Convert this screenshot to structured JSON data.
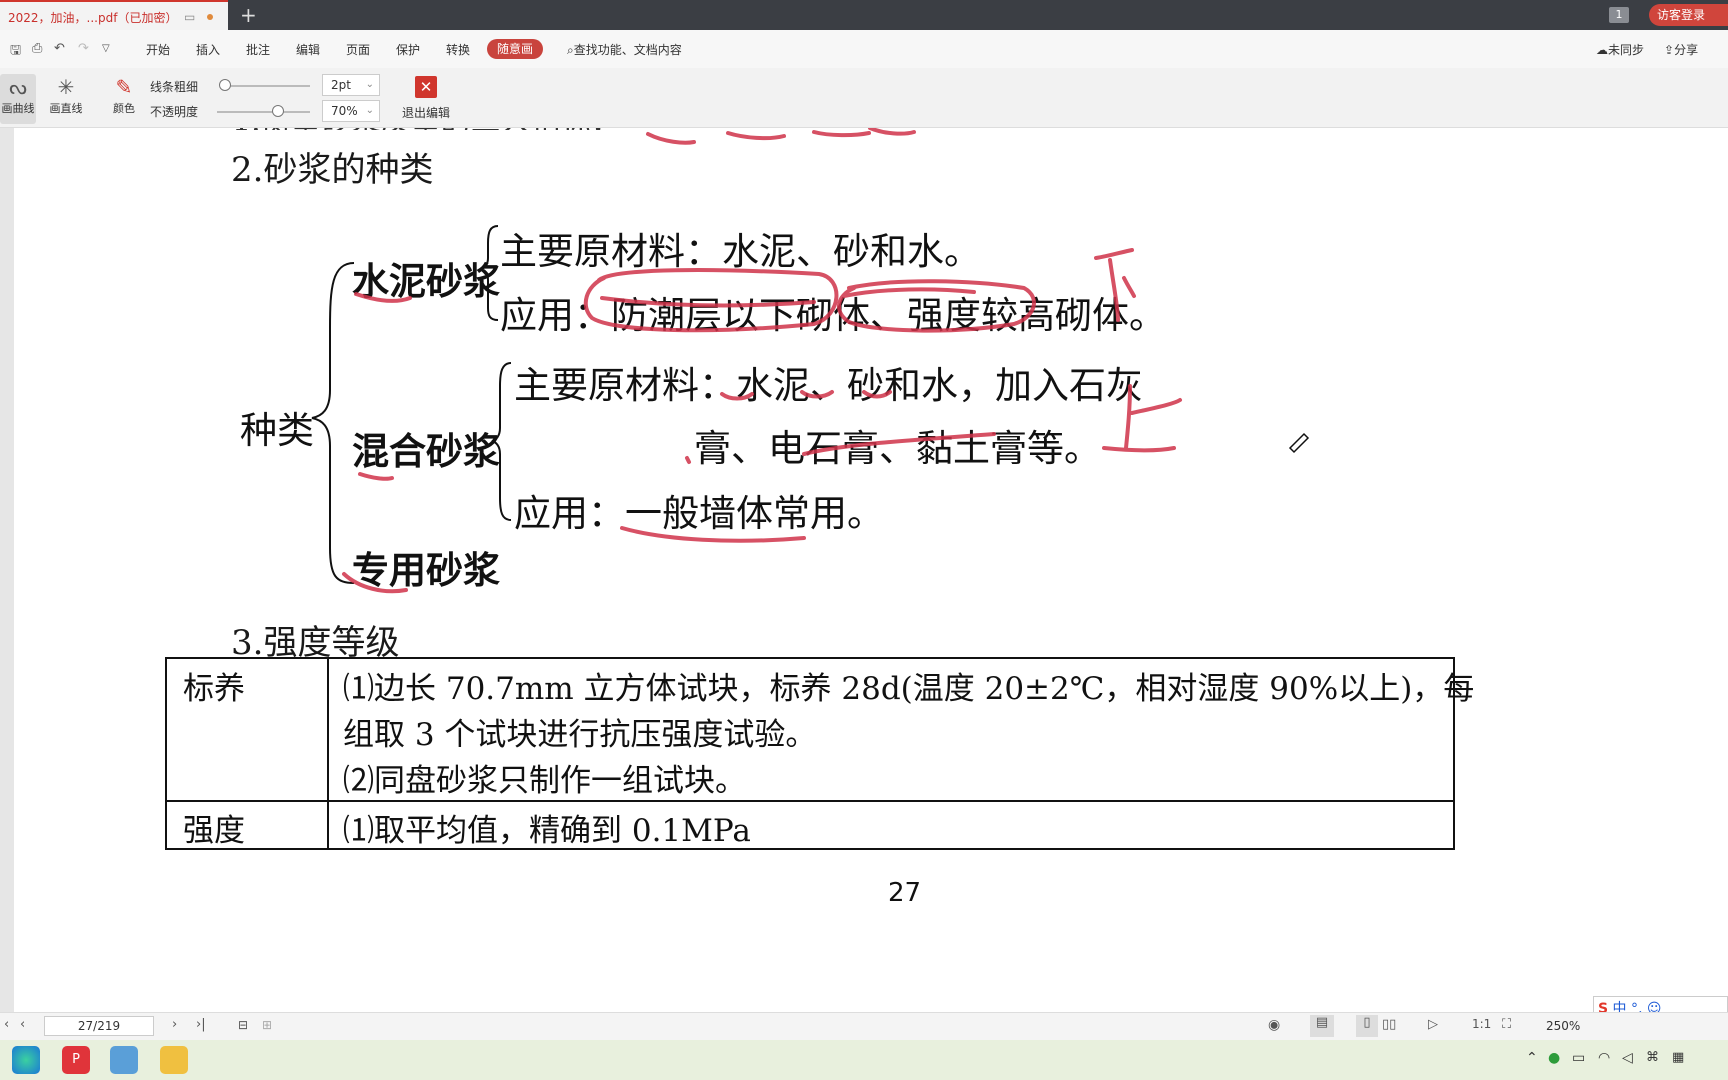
{
  "tab": {
    "title": "2022，加油，...pdf（已加密）"
  },
  "titlebar": {
    "page_count": "1",
    "login": "访客登录"
  },
  "menu": {
    "items": [
      "开始",
      "插入",
      "批注",
      "编辑",
      "页面",
      "保护",
      "转换"
    ],
    "active": "随意画",
    "search": "查找功能、文档内容",
    "sync": "未同步",
    "share": "分享"
  },
  "ink": {
    "curve": "画曲线",
    "line": "画直线",
    "color": "颜色",
    "thickness_label": "线条粗细",
    "thickness_value": "2pt",
    "opacity_label": "不透明度",
    "opacity_value": "70%",
    "opacity_level": 0.7,
    "exit": "退出编辑",
    "accent": "#d0362d"
  },
  "doc": {
    "section2": "2.砂浆的种类",
    "root": "种类",
    "cement": {
      "name": "水泥砂浆",
      "material": "主要原材料：水泥、砂和水。",
      "use": "应用：防潮层以下砌体、强度较高砌体。"
    },
    "mixed": {
      "name": "混合砂浆",
      "material_1": "主要原材料：水泥、砂和水，加入石灰",
      "material_2": "膏、电石膏、黏土膏等。",
      "use": "应用：一般墙体常用。"
    },
    "special": {
      "name": "专用砂浆"
    },
    "section3": "3.强度等级",
    "table": {
      "rows": [
        {
          "head": "标养",
          "lines": [
            "⑴边长 70.7mm 立方体试块，标养 28d(温度 20±2℃，相对湿度 90%以上)，每",
            "组取 3 个试块进行抗压强度试验。",
            "⑵同盘砂浆只制作一组试块。"
          ]
        },
        {
          "head": "强度",
          "lines": [
            "⑴取平均值，精确到 0.1MPa"
          ]
        }
      ]
    },
    "page_number": "27",
    "handwriting": {
      "lower": "下",
      "upper": "上"
    }
  },
  "status": {
    "page": "27/219",
    "zoom": "250%"
  },
  "ime": {
    "text": "中 °, ☺"
  }
}
